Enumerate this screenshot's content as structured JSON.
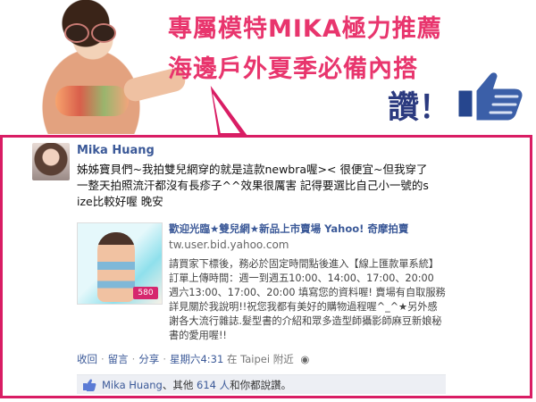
{
  "header": {
    "headline_line1": "專屬模特MIKA極力推薦",
    "headline_line2": "海邊戶外夏季必備內搭",
    "like_label": "讚！"
  },
  "post": {
    "author": "Mika Huang",
    "message": "姊姊寶貝們~我拍雙兒網穿的就是這款newbra喔>< 很便宜~但我穿了一整天拍照流汗都沒有長疹子^^效果很厲害 記得要選比自己小一號的size比較好喔 晚安",
    "shared": {
      "title": "歡迎光臨★雙兒網★新品上市賣場 Yahoo! 奇摩拍賣",
      "url": "tw.user.bid.yahoo.com",
      "description": "請買家下標後，務必於固定時間點後進入【線上匯款單系統】訂單上傳時間：週一到週五10:00、14:00、17:00、20:00 週六13:00、17:00、20:00 填寫您的資料喔! 賣場有自取服務詳見關於我說明!!祝您我都有美好的購物過程喔^_^★另外感謝各大流行雜誌.髮型書的介紹和眾多造型師攝影師麻豆新娘秘書的愛用喔!!",
      "thumb_price": "580"
    },
    "actions": {
      "back": "收回",
      "comment": "留言",
      "share": "分享",
      "timestamp": "星期六4:31",
      "location": "在 Taipei 附近"
    },
    "likes": {
      "names": "Mika Huang",
      "others_prefix": "、其他",
      "others_link": "614 人",
      "suffix": "和你都說讚。"
    }
  },
  "colors": {
    "headline": "#e8356d",
    "like_label": "#2b3a7f",
    "callout_border": "#d91d64",
    "facebook_link": "#3b5998",
    "likes_background": "#edeff4"
  }
}
